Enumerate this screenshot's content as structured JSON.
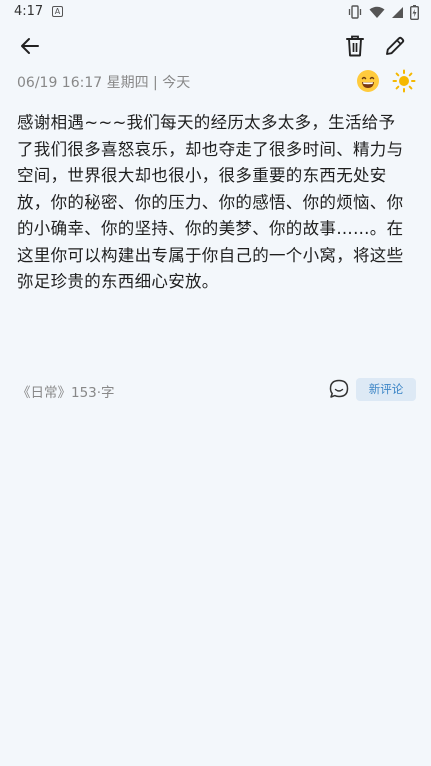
{
  "status_bar": {
    "time": "4:17",
    "notification_badge": "A",
    "icons": [
      "vibrate-icon",
      "wifi-icon",
      "signal-icon",
      "battery-icon"
    ]
  },
  "toolbar": {
    "back_icon": "arrow-left-icon",
    "delete_icon": "trash-icon",
    "edit_icon": "pencil-icon"
  },
  "entry": {
    "date_text": "06/19 16:17 星期四 | 今天",
    "mood_icon": "grinning-face-icon",
    "weather_icon": "sun-icon",
    "content": "感谢相遇~~~我们每天的经历太多太多，生活给予了我们很多喜怒哀乐，却也夺走了很多时间、精力与空间，世界很大却也很小，很多重要的东西无处安放，你的秘密、你的压力、你的感悟、你的烦恼、你的小确幸、你的坚持、你的美梦、你的故事……。在这里你可以构建出专属于你自己的一个小窝，将这些弥足珍贵的东西细心安放。"
  },
  "footer": {
    "info_text": "《日常》153·字",
    "comment_icon": "comment-bubble-icon",
    "new_comment_label": "新评论"
  },
  "colors": {
    "background": "#f3f7fb",
    "accent": "#3c85c6",
    "button_bg": "#dde9f5",
    "meta_text": "#888888",
    "sun": "#f5b800"
  }
}
